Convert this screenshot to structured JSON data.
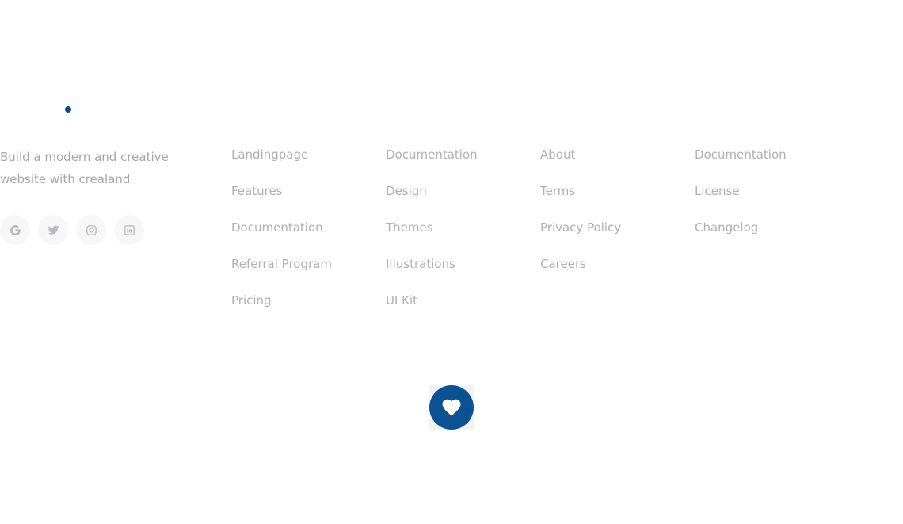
{
  "brand": {
    "tagline": "Build a modern and creative website with crealand",
    "accent_color": "#0a4a8a"
  },
  "socials": [
    {
      "icon": "google-icon"
    },
    {
      "icon": "twitter-icon"
    },
    {
      "icon": "instagram-icon"
    },
    {
      "icon": "linkedin-icon"
    }
  ],
  "columns": [
    {
      "links": [
        "Landingpage",
        "Features",
        "Documentation",
        "Referral Program",
        "Pricing"
      ]
    },
    {
      "links": [
        "Documentation",
        "Design",
        "Themes",
        "Illustrations",
        "UI Kit"
      ]
    },
    {
      "links": [
        "About",
        "Terms",
        "Privacy Policy",
        "Careers"
      ]
    },
    {
      "links": [
        "Documentation",
        "License",
        "Changelog"
      ]
    }
  ],
  "love_button": {
    "icon": "heart-icon",
    "color": "#0a5291"
  }
}
